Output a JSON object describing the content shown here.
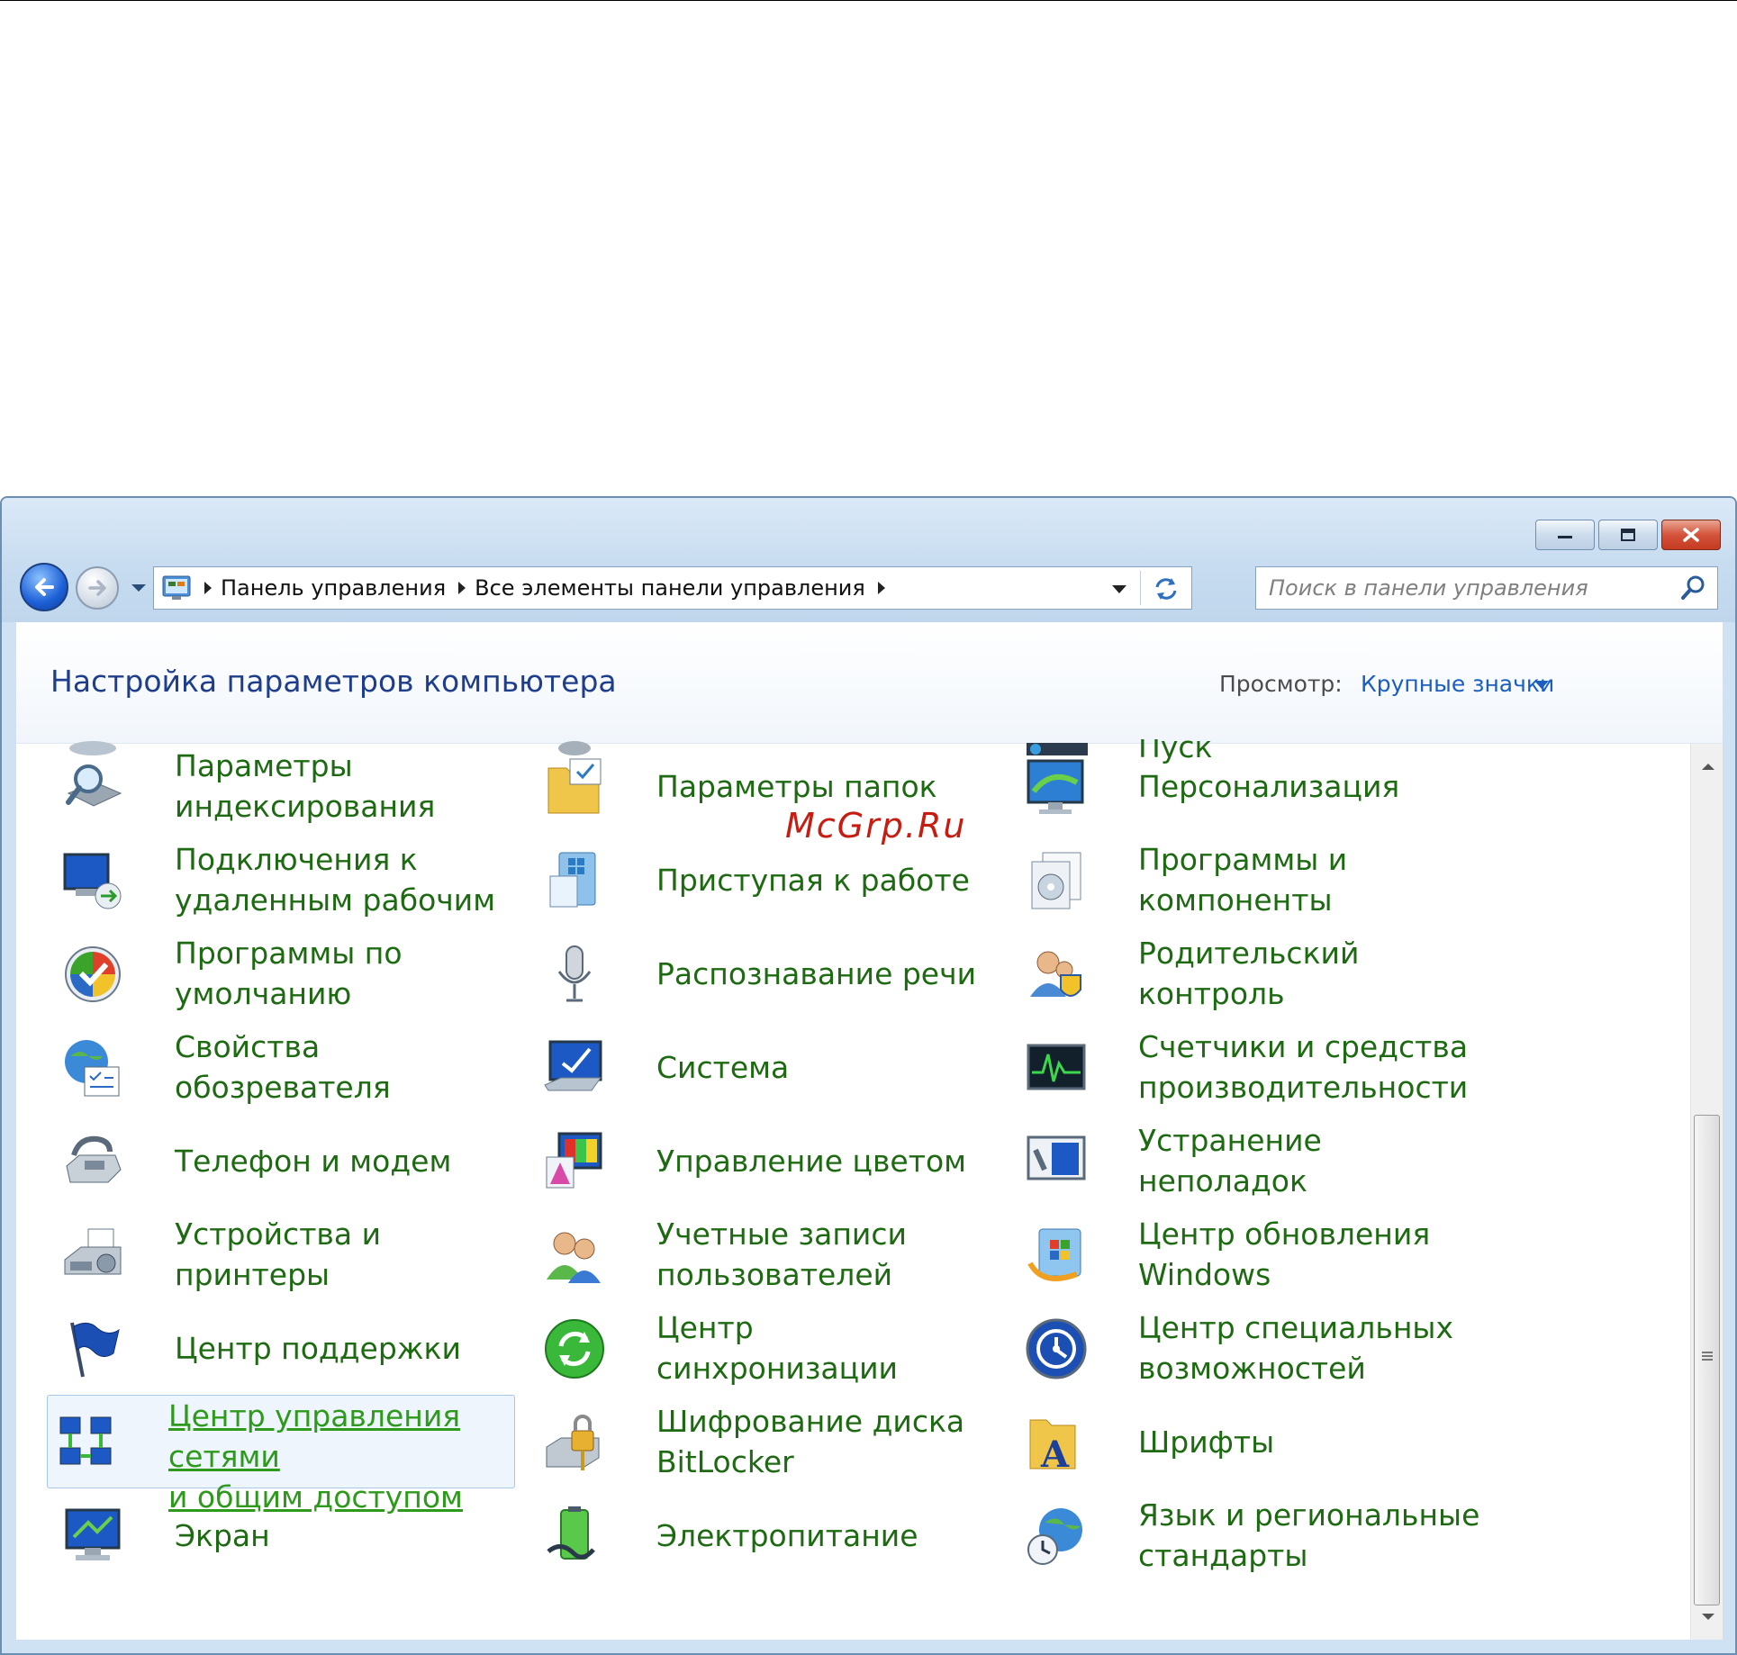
{
  "window": {
    "controls": {
      "minimize": "minimize",
      "maximize": "maximize",
      "close": "close"
    }
  },
  "address": {
    "crumbs": [
      "Панель управления",
      "Все элементы панели управления"
    ]
  },
  "search": {
    "placeholder": "Поиск в панели управления"
  },
  "header": {
    "title": "Настройка параметров компьютера",
    "view_label": "Просмотр:",
    "view_value": "Крупные значки"
  },
  "items": [
    {
      "label": "Пуск",
      "icon": "taskbar-icon"
    },
    {
      "label": "Параметры\nиндексирования",
      "icon": "indexing-icon"
    },
    {
      "label": "Параметры папок",
      "icon": "folder-options-icon"
    },
    {
      "label": "Персонализация",
      "icon": "personalization-icon"
    },
    {
      "label": "Подключения к\nудаленным рабочим",
      "icon": "remote-desktop-icon"
    },
    {
      "label": "Приступая к работе",
      "icon": "getting-started-icon"
    },
    {
      "label": "Программы и\nкомпоненты",
      "icon": "programs-icon"
    },
    {
      "label": "Программы по\nумолчанию",
      "icon": "default-programs-icon"
    },
    {
      "label": "Распознавание речи",
      "icon": "microphone-icon"
    },
    {
      "label": "Родительский контроль",
      "icon": "parental-control-icon"
    },
    {
      "label": "Свойства обозревателя",
      "icon": "internet-options-icon"
    },
    {
      "label": "Система",
      "icon": "system-icon"
    },
    {
      "label": "Счетчики и средства\nпроизводительности",
      "icon": "performance-icon"
    },
    {
      "label": "Телефон и модем",
      "icon": "phone-modem-icon"
    },
    {
      "label": "Управление цветом",
      "icon": "color-management-icon"
    },
    {
      "label": "Устранение неполадок",
      "icon": "troubleshooting-icon"
    },
    {
      "label": "Устройства и принтеры",
      "icon": "devices-printers-icon"
    },
    {
      "label": "Учетные записи\nпользователей",
      "icon": "user-accounts-icon"
    },
    {
      "label": "Центр обновления\nWindows",
      "icon": "windows-update-icon"
    },
    {
      "label": "Центр поддержки",
      "icon": "action-center-flag-icon"
    },
    {
      "label": "Центр синхронизации",
      "icon": "sync-center-icon"
    },
    {
      "label": "Центр специальных\nвозможностей",
      "icon": "ease-of-access-icon"
    },
    {
      "label": "Центр управления сетями\nи общим доступом",
      "icon": "network-center-icon"
    },
    {
      "label": "Шифрование диска\nBitLocker",
      "icon": "bitlocker-icon"
    },
    {
      "label": "Шрифты",
      "icon": "fonts-icon"
    },
    {
      "label": "Экран",
      "icon": "display-icon"
    },
    {
      "label": "Электропитание",
      "icon": "power-options-icon"
    },
    {
      "label": "Язык и региональные\nстандарты",
      "icon": "region-language-icon"
    }
  ],
  "watermark": "McGrp.Ru",
  "colors": {
    "link_green": "#1e6a12",
    "title_blue": "#1e3e8c",
    "view_blue": "#1a5fc0",
    "watermark_red": "#c61c12"
  }
}
